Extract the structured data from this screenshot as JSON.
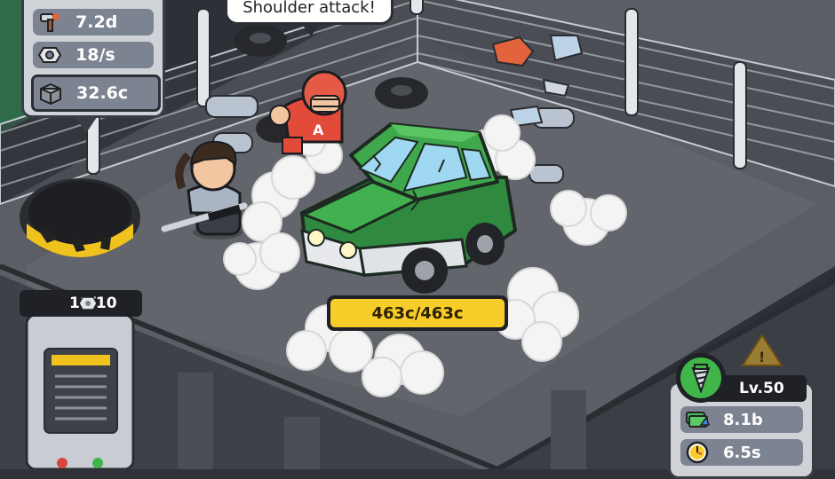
{
  "stats": {
    "row1": {
      "icon": "hammer-icon",
      "value": "7.2d"
    },
    "row2": {
      "icon": "nut-icon",
      "value": "18/s"
    },
    "row3": {
      "icon": "cash-crate-icon",
      "value": "32.6c"
    }
  },
  "speech_bubble": {
    "text": "Shoulder attack!"
  },
  "target_hp": {
    "text": "463c/463c",
    "fraction": 1.0,
    "color": "#f7cd2a"
  },
  "counter": {
    "icon": "nut-icon",
    "text": "12/10"
  },
  "upgrade_panel": {
    "icon": "drill-icon",
    "level": "Lv.50",
    "rows": [
      {
        "icon": "cash-upgrade-icon",
        "value": "8.1b"
      },
      {
        "icon": "clock-icon",
        "value": "6.5s"
      }
    ]
  },
  "colors": {
    "car": "#3aa04a",
    "floor": "#5a5d63",
    "fence": "#d8dbe0",
    "accent_yellow": "#f7cd2a"
  }
}
